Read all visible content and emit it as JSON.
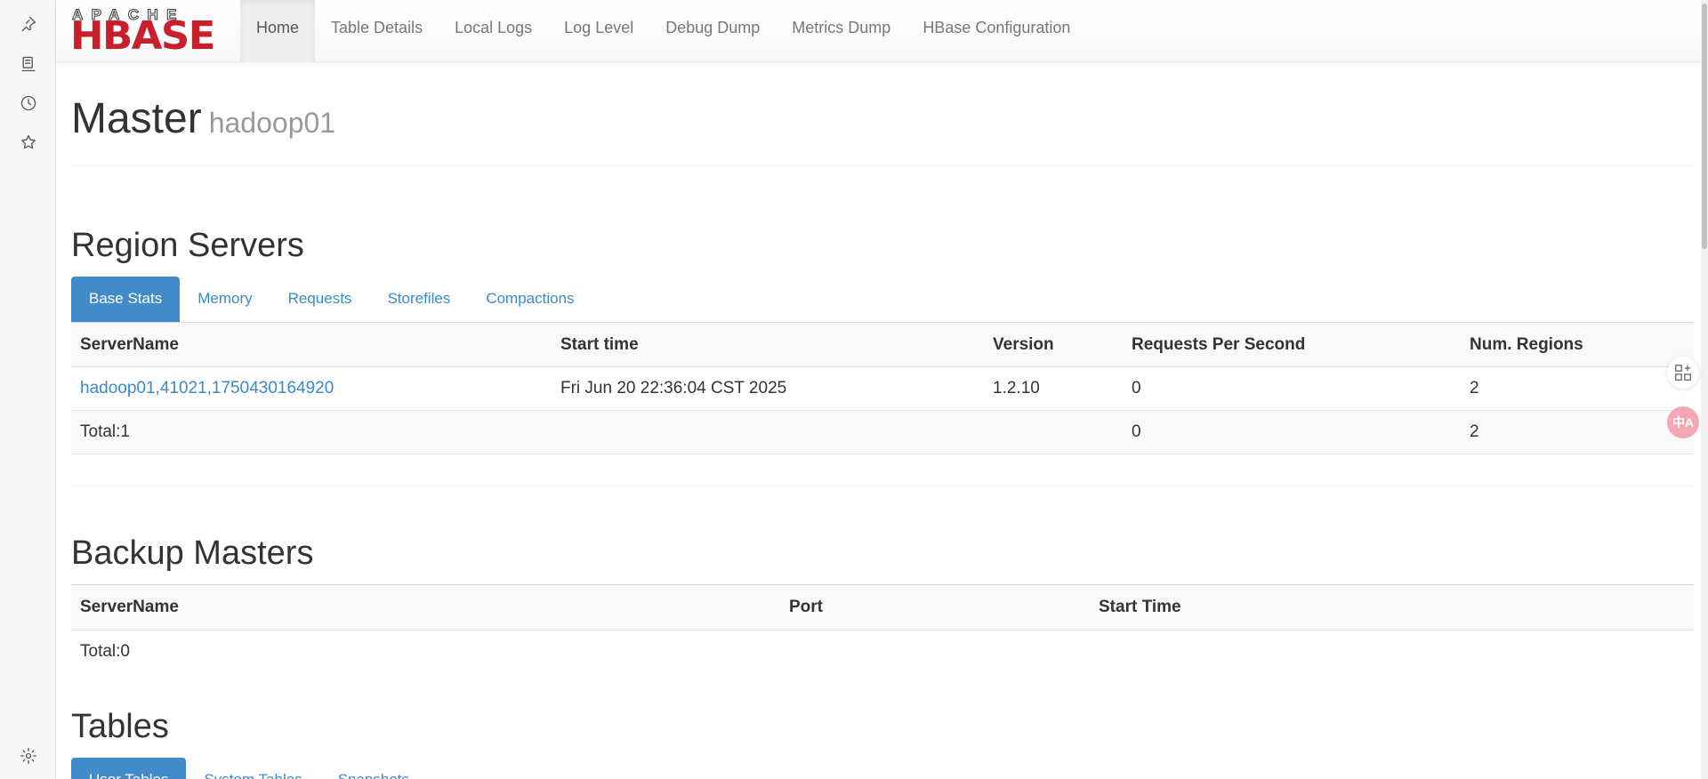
{
  "nav": {
    "logo_top": "APACHE",
    "logo_main": "HBASE",
    "items": [
      "Home",
      "Table Details",
      "Local Logs",
      "Log Level",
      "Debug Dump",
      "Metrics Dump",
      "HBase Configuration"
    ]
  },
  "page": {
    "title": "Master",
    "host": "hadoop01"
  },
  "region_servers": {
    "heading": "Region Servers",
    "tabs": [
      "Base Stats",
      "Memory",
      "Requests",
      "Storefiles",
      "Compactions"
    ],
    "columns": [
      "ServerName",
      "Start time",
      "Version",
      "Requests Per Second",
      "Num. Regions"
    ],
    "rows": [
      [
        "hadoop01,41021,1750430164920",
        "Fri Jun 20 22:36:04 CST 2025",
        "1.2.10",
        "0",
        "2"
      ]
    ],
    "total": [
      "Total:1",
      "",
      "",
      "0",
      "2"
    ]
  },
  "backup_masters": {
    "heading": "Backup Masters",
    "columns": [
      "ServerName",
      "Port",
      "Start Time"
    ],
    "total": "Total:0"
  },
  "tables": {
    "heading": "Tables",
    "tabs": [
      "User Tables",
      "System Tables",
      "Snapshots"
    ]
  },
  "widgets": {
    "translate_label": "中A"
  }
}
